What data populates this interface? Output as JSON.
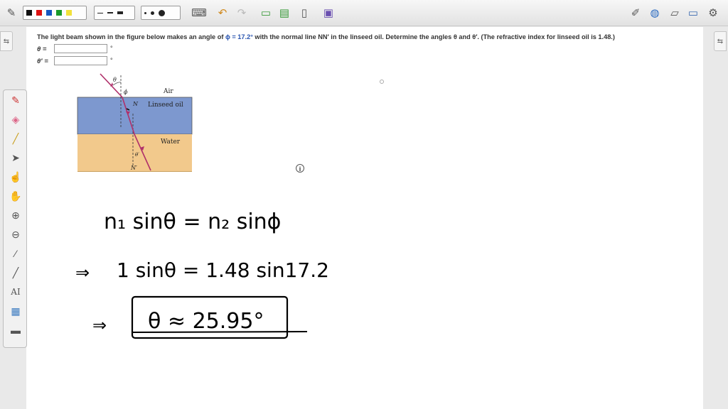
{
  "question": {
    "part1": "The light beam shown in the figure below makes an angle of ",
    "phi": "ϕ = 17.2°",
    "part2": " with the normal line NN′ in the linseed oil. Determine the angles θ and θ′. (The refractive index for linseed oil is 1.48.)"
  },
  "answers": [
    {
      "label": "θ =",
      "value": "",
      "unit": "°"
    },
    {
      "label": "θ′ =",
      "value": "",
      "unit": "°"
    }
  ],
  "figure": {
    "theta": "θ",
    "phi": "ϕ",
    "air": "Air",
    "oil": "Linseed oil",
    "water": "Water",
    "n": "N",
    "nprime": "N′",
    "thetaprime": "θ′"
  },
  "handwriting": {
    "line1": "n₁ sinθ = n₂ sinϕ",
    "line2_arrow": "⇒",
    "line2": "1 sinθ = 1.48 sin17.2",
    "line3_arrow": "⇒",
    "line3": "θ ≈ 25.95°"
  },
  "info": "i",
  "colors": {
    "oil": "#7d98cf",
    "water": "#f2c98c",
    "ray": "#b0306a",
    "ink": "#000000"
  }
}
